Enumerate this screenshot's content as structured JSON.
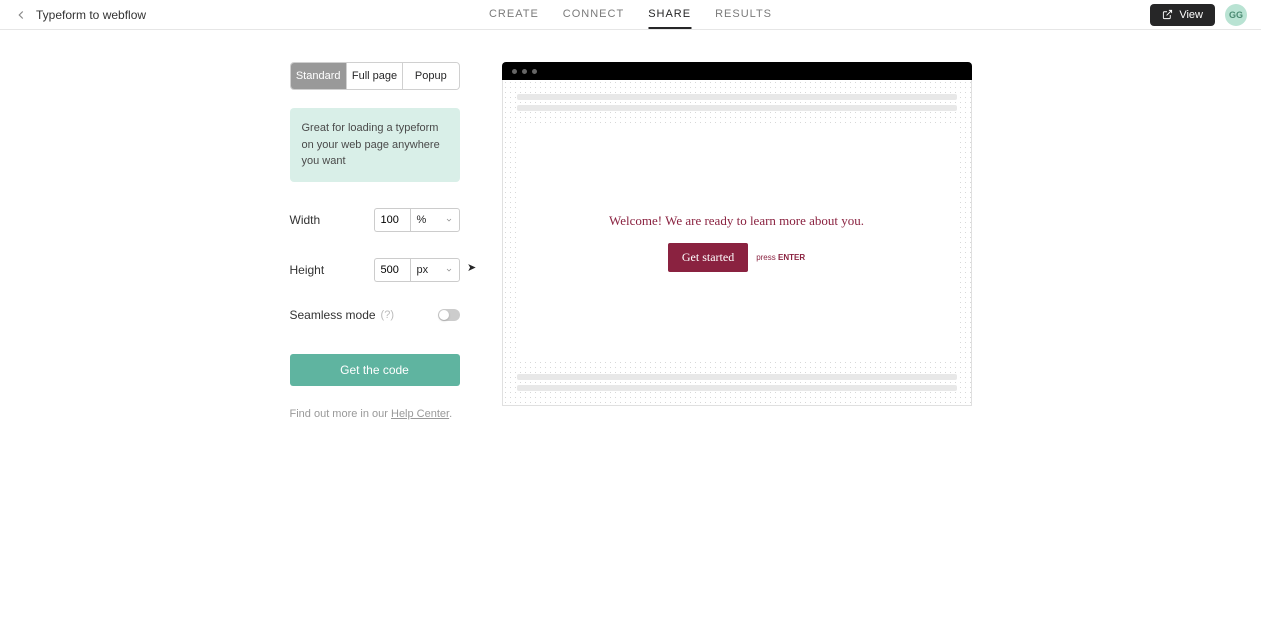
{
  "header": {
    "project_title": "Typeform to webflow",
    "nav": [
      "CREATE",
      "CONNECT",
      "SHARE",
      "RESULTS"
    ],
    "active_nav": "SHARE",
    "view_label": "View",
    "avatar_initials": "GG"
  },
  "tabs": {
    "items": [
      "Standard",
      "Full page",
      "Popup"
    ],
    "active": "Standard"
  },
  "info_text": "Great for loading a typeform on your web page anywhere you want",
  "fields": {
    "width": {
      "label": "Width",
      "value": "100",
      "unit": "%"
    },
    "height": {
      "label": "Height",
      "value": "500",
      "unit": "px"
    }
  },
  "seamless": {
    "label": "Seamless mode",
    "help": "(?)",
    "on": false
  },
  "get_code_label": "Get the code",
  "help": {
    "prefix": "Find out more in our ",
    "link": "Help Center",
    "suffix": "."
  },
  "preview": {
    "welcome": "Welcome! We are ready to learn more about you.",
    "button": "Get started",
    "press": "press",
    "enter": "ENTER"
  }
}
